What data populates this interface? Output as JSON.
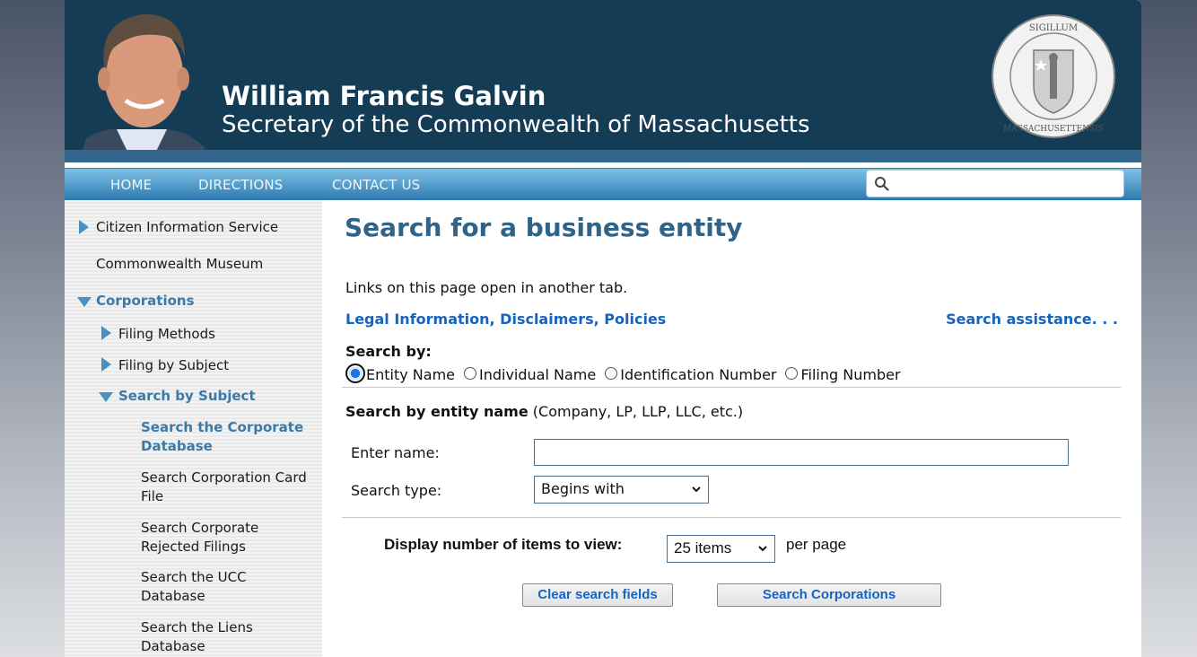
{
  "header": {
    "name": "William Francis Galvin",
    "subtitle": "Secretary of the Commonwealth of Massachusetts",
    "seal_alt": "Massachusetts state seal",
    "colors": {
      "header_bg": "#143c55",
      "nav_accent": "#4a8fc0",
      "link": "#1565c0",
      "title": "#2f6388"
    }
  },
  "nav": {
    "items": [
      {
        "label": "HOME"
      },
      {
        "label": "DIRECTIONS"
      },
      {
        "label": "CONTACT US"
      }
    ],
    "search": {
      "placeholder": "",
      "value": "",
      "icon": "search-icon"
    }
  },
  "sidebar": {
    "items": [
      {
        "label": "Citizen Information Service",
        "icon": "triangle-right-icon"
      },
      {
        "label": "Commonwealth Museum"
      },
      {
        "label": "Corporations",
        "icon": "triangle-down-icon",
        "active": true
      },
      {
        "label": "Filing Methods",
        "icon": "triangle-right-icon"
      },
      {
        "label": "Filing by Subject",
        "icon": "triangle-right-icon"
      },
      {
        "label": "Search by Subject",
        "icon": "triangle-down-icon",
        "active": true
      },
      {
        "label": "Search the Corporate Database",
        "active": true
      },
      {
        "label": "Search Corporation Card File"
      },
      {
        "label": "Search Corporate Rejected Filings"
      },
      {
        "label": "Search the UCC Database"
      },
      {
        "label": "Search the Liens Database"
      }
    ]
  },
  "main": {
    "title": "Search for a business entity",
    "note": "Links on this page open in another tab.",
    "legal_link": "Legal Information, Disclaimers, Policies",
    "assist_link": "Search assistance. . .",
    "search_by_label": "Search by:",
    "search_by_options": [
      {
        "label": "Entity Name",
        "checked": true
      },
      {
        "label": "Individual Name",
        "checked": false
      },
      {
        "label": "Identification Number",
        "checked": false
      },
      {
        "label": "Filing Number",
        "checked": false
      }
    ],
    "section_heading": "Search by entity name",
    "section_hint": "(Company, LP, LLP, LLC, etc.)",
    "enter_name_label": "Enter name:",
    "enter_name_value": "",
    "search_type_label": "Search type:",
    "search_type_value": "Begins with",
    "display_label": "Display number of items to view:",
    "display_value": "25 items",
    "per_page": "per page",
    "clear_button": "Clear search fields",
    "search_button": "Search Corporations"
  }
}
